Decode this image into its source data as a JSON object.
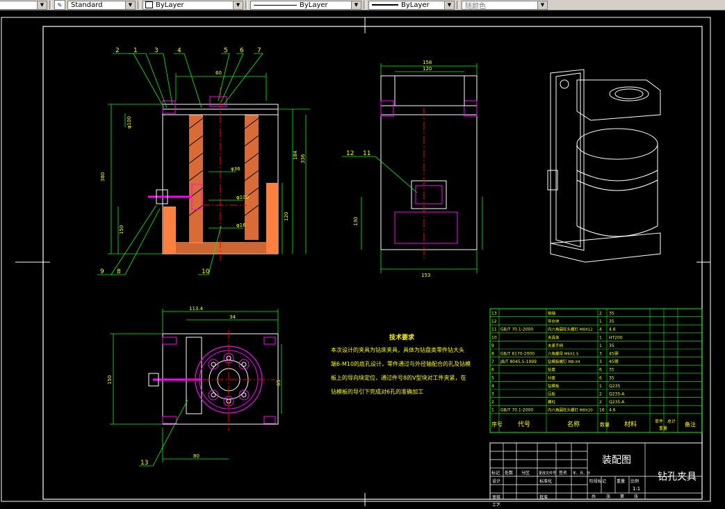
{
  "toolbar": {
    "text_style": "Standard",
    "layer": "ByLayer",
    "linetype": "ByLayer",
    "lineweight": "ByLayer",
    "color": "随颜色"
  },
  "techreq": {
    "title": "技术要求",
    "lines": [
      "本次设计的夹具为钻床夹具，具体为钻盘类零件钻大头",
      "端6-M10的底孔设计，零件通过与外径轴配合的孔及钻模",
      "板上的导向块定位，通过件号8的V型块对工件夹紧，在",
      "钻模板的导引下完成对6孔的准确加工"
    ]
  },
  "parts": {
    "rows": [
      {
        "no": "13",
        "code": "",
        "name": "销轴",
        "qty": "2",
        "mat": "35",
        "note": ""
      },
      {
        "no": "12",
        "code": "",
        "name": "导向块",
        "qty": "1",
        "mat": "35",
        "note": ""
      },
      {
        "no": "11",
        "code": "GB/T 70.1-2000",
        "name": "内六角圆柱头螺钉 M8X12",
        "qty": "4",
        "mat": "4.6",
        "note": ""
      },
      {
        "no": "10",
        "code": "",
        "name": "夹具体",
        "qty": "1",
        "mat": "HT200",
        "note": ""
      },
      {
        "no": "9",
        "code": "",
        "name": "夹紧手柄",
        "qty": "1",
        "mat": "35",
        "note": ""
      },
      {
        "no": "8",
        "code": "GB/T 6170-2000",
        "name": "六角螺母 M6X1.5",
        "qty": "3",
        "mat": "45钢",
        "note": ""
      },
      {
        "no": "7",
        "code": "JB/T 8045.5-1999",
        "name": "钻模板螺钉 M8-X4",
        "qty": "3",
        "mat": "45钢",
        "note": ""
      },
      {
        "no": "6",
        "code": "",
        "name": "钻套",
        "qty": "6",
        "mat": "35",
        "note": ""
      },
      {
        "no": "5",
        "code": "",
        "name": "衬套",
        "qty": "6",
        "mat": "35",
        "note": ""
      },
      {
        "no": "4",
        "code": "",
        "name": "钻模板",
        "qty": "1",
        "mat": "Q235",
        "note": ""
      },
      {
        "no": "3",
        "code": "",
        "name": "压板",
        "qty": "2",
        "mat": "Q235-A",
        "note": ""
      },
      {
        "no": "2",
        "code": "",
        "name": "螺柱",
        "qty": "2",
        "mat": "Q235-A",
        "note": ""
      },
      {
        "no": "1",
        "code": "GB/T 70.1-2000",
        "name": "内六角圆柱头螺钉 M8X20",
        "qty": "16",
        "mat": "4.6",
        "note": ""
      }
    ],
    "header": {
      "no": "序号",
      "code": "代号",
      "name": "名称",
      "qty": "数量",
      "mat": "材料",
      "unit_w": "单件",
      "total_w": "总计",
      "weight": "重量",
      "note": "备注"
    }
  },
  "titleblock": {
    "drawing_type": "装配图",
    "drawing_name": "钻孔夹具",
    "scale": "1:1",
    "rev_labels": [
      "标记",
      "处数",
      "分区",
      "更改文件号",
      "签名",
      "年、月、日"
    ],
    "labels_left": [
      "设计",
      "审核",
      "工艺"
    ],
    "std_label": "标准化",
    "approve_label": "批准",
    "stage_labels": [
      "阶段标记",
      "重量",
      "比例"
    ],
    "sheet_labels": [
      "共",
      "张",
      "第",
      "张"
    ]
  },
  "dims": {
    "front": [
      "380",
      "336",
      "184",
      "120",
      "60",
      "150",
      "φ16",
      "φ100",
      "φ36"
    ],
    "side": [
      "158",
      "120",
      "130",
      "153"
    ],
    "top": [
      "113.4",
      "80",
      "34",
      "65",
      "150"
    ]
  },
  "balloons": {
    "front": [
      "2",
      "1",
      "3",
      "4",
      "5",
      "6",
      "7",
      "9",
      "8",
      "10"
    ],
    "side": [
      "12",
      "11"
    ],
    "top": [
      "13"
    ]
  },
  "colors": {
    "bg": "#000000",
    "border": "#ffffff",
    "dim": "#00ff00",
    "part": "#ff00ff",
    "hatch": "#ff7f3f",
    "center": "#ff0000",
    "text": "#ffff00"
  }
}
